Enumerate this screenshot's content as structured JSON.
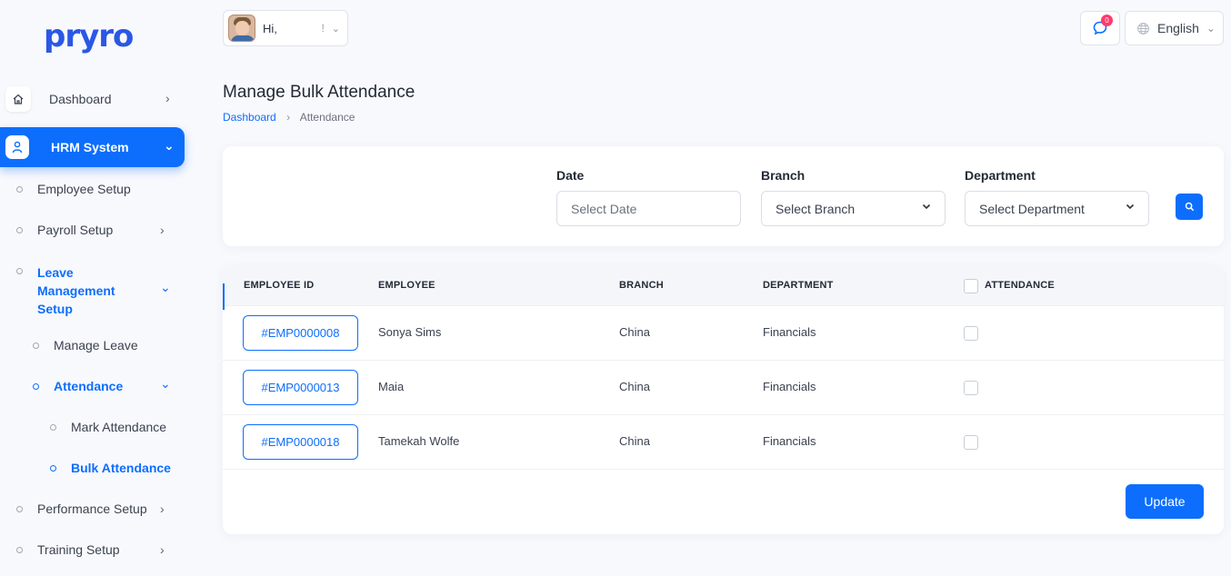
{
  "brand": {
    "logo_text": "pryro",
    "accent": "#0d6efd"
  },
  "header": {
    "greeting": "Hi,",
    "user_mark": "!",
    "notification_count": "0",
    "language": "English"
  },
  "sidebar": {
    "dashboard": "Dashboard",
    "hrm_system": "HRM System",
    "employee_setup": "Employee Setup",
    "payroll_setup": "Payroll Setup",
    "leave_management_setup": "Leave Management Setup",
    "manage_leave": "Manage Leave",
    "attendance": "Attendance",
    "mark_attendance": "Mark Attendance",
    "bulk_attendance": "Bulk Attendance",
    "performance_setup": "Performance Setup",
    "training_setup": "Training Setup"
  },
  "page": {
    "title": "Manage Bulk Attendance",
    "breadcrumb": [
      "Dashboard",
      "Attendance"
    ]
  },
  "filters": {
    "date_label": "Date",
    "date_placeholder": "Select Date",
    "branch_label": "Branch",
    "branch_value": "Select Branch",
    "department_label": "Department",
    "department_value": "Select Department"
  },
  "table": {
    "headers": [
      "EMPLOYEE ID",
      "EMPLOYEE",
      "BRANCH",
      "DEPARTMENT",
      "ATTENDANCE"
    ],
    "rows": [
      {
        "id": "#EMP0000008",
        "employee": "Sonya Sims",
        "branch": "China",
        "department": "Financials"
      },
      {
        "id": "#EMP0000013",
        "employee": "Maia",
        "branch": "China",
        "department": "Financials"
      },
      {
        "id": "#EMP0000018",
        "employee": "Tamekah Wolfe",
        "branch": "China",
        "department": "Financials"
      }
    ],
    "update_label": "Update"
  }
}
